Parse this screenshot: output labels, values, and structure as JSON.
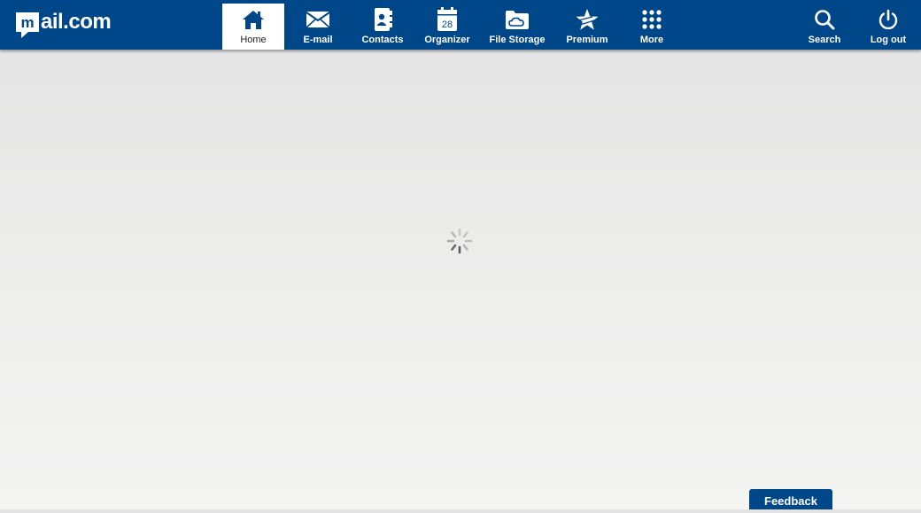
{
  "brand": {
    "logo_text": "ail.com",
    "logo_letter": "m",
    "primary_color": "#004789",
    "background_top": "#e4e4e4",
    "background_bottom": "#f4f4f3"
  },
  "nav": {
    "items": [
      {
        "label": "Home",
        "icon": "home-icon",
        "active": true
      },
      {
        "label": "E-mail",
        "icon": "envelope-icon"
      },
      {
        "label": "Contacts",
        "icon": "contacts-book-icon"
      },
      {
        "label": "Organizer",
        "icon": "calendar-icon",
        "icon_text": "28"
      },
      {
        "label": "File Storage",
        "icon": "cloud-folder-icon"
      },
      {
        "label": "Premium",
        "icon": "star-icon"
      },
      {
        "label": "More",
        "icon": "grid-dots-icon"
      }
    ],
    "right": [
      {
        "label": "Search",
        "icon": "search-icon"
      },
      {
        "label": "Log out",
        "icon": "power-icon"
      }
    ]
  },
  "main": {
    "loading": true,
    "spinner_icon": "loading-spinner-icon"
  },
  "feedback": {
    "label": "Feedback"
  }
}
